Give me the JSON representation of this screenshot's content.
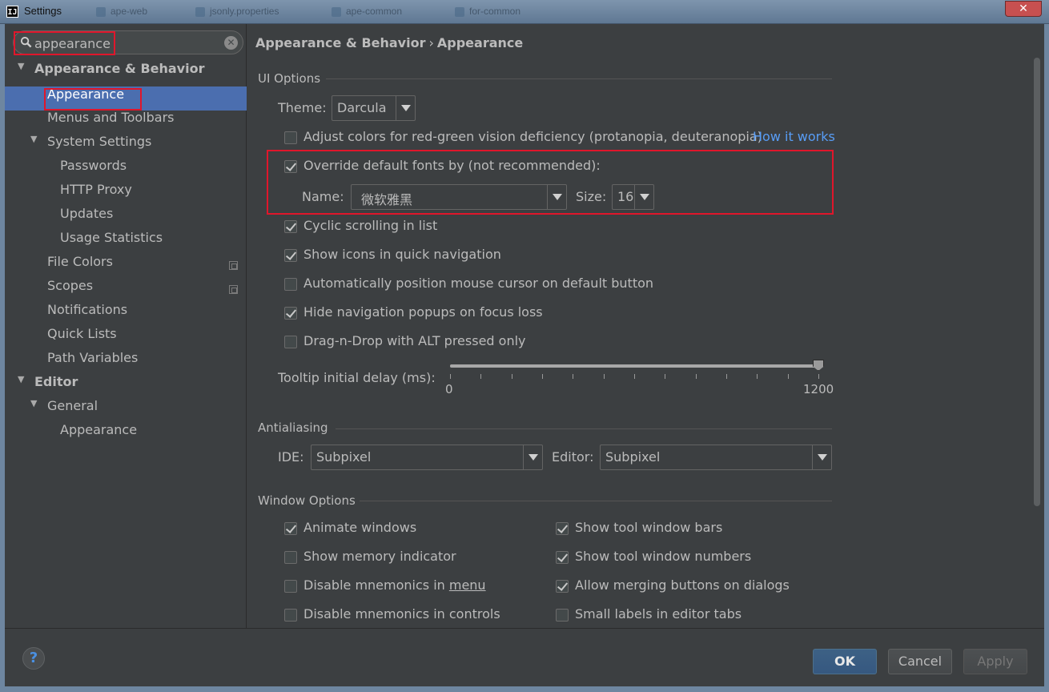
{
  "window": {
    "title": "Settings",
    "app_icon": "IJ",
    "bg_tabs": [
      "ape-web",
      "jsonly.properties",
      "ape-common",
      "for-common"
    ],
    "close_glyph": "✕"
  },
  "search": {
    "value": "appearance",
    "clear_glyph": "✕"
  },
  "sidebar": {
    "appearance_behavior": "Appearance & Behavior",
    "appearance": "Appearance",
    "menus_toolbars": "Menus and Toolbars",
    "system_settings": "System Settings",
    "passwords": "Passwords",
    "http_proxy": "HTTP Proxy",
    "updates": "Updates",
    "usage_statistics": "Usage Statistics",
    "file_colors": "File Colors",
    "scopes": "Scopes",
    "notifications": "Notifications",
    "quick_lists": "Quick Lists",
    "path_variables": "Path Variables",
    "editor": "Editor",
    "general": "General",
    "editor_appearance": "Appearance",
    "expanded_glyph": "▼"
  },
  "breadcrumb": {
    "part1": "Appearance & Behavior",
    "sep": "›",
    "part2": "Appearance"
  },
  "ui_options": {
    "title": "UI Options",
    "theme_label": "Theme:",
    "theme_value": "Darcula",
    "adjust_colors": "Adjust colors for red-green vision deficiency (protanopia, deuteranopia)",
    "how_it_works": "How it works",
    "override_fonts": "Override default fonts by (not recommended):",
    "name_label": "Name:",
    "name_value": "微软雅黑",
    "size_label": "Size:",
    "size_value": "16",
    "cyclic_scrolling": "Cyclic scrolling in list",
    "show_icons": "Show icons in quick navigation",
    "auto_position": "Automatically position mouse cursor on default button",
    "hide_popups": "Hide navigation popups on focus loss",
    "drag_drop": "Drag-n-Drop with ALT pressed only",
    "tooltip_label": "Tooltip initial delay (ms):",
    "tooltip_min": "0",
    "tooltip_max": "1200",
    "tooltip_value": 1200,
    "checked": {
      "adjust_colors": false,
      "override_fonts": true,
      "cyclic_scrolling": true,
      "show_icons": true,
      "auto_position": false,
      "hide_popups": true,
      "drag_drop": false
    }
  },
  "antialiasing": {
    "title": "Antialiasing",
    "ide_label": "IDE:",
    "ide_value": "Subpixel",
    "editor_label": "Editor:",
    "editor_value": "Subpixel"
  },
  "window_options": {
    "title": "Window Options",
    "animate_windows": "Animate windows",
    "show_memory": "Show memory indicator",
    "disable_mnemonics_menu_pre": "Disable mnemonics in ",
    "disable_mnemonics_menu_u": "menu",
    "disable_mnemonics_controls": "Disable mnemonics in controls",
    "show_tool_bars": "Show tool window bars",
    "show_tool_numbers": "Show tool window numbers",
    "allow_merging": "Allow merging buttons on dialogs",
    "small_labels": "Small labels in editor tabs",
    "checked": {
      "animate_windows": true,
      "show_memory": false,
      "disable_mnemonics_menu": false,
      "disable_mnemonics_controls": false,
      "show_tool_bars": true,
      "show_tool_numbers": true,
      "allow_merging": true,
      "small_labels": false
    }
  },
  "buttons": {
    "help": "?",
    "ok": "OK",
    "cancel": "Cancel",
    "apply": "Apply"
  },
  "colors": {
    "accent": "#4b6eaf",
    "link": "#589df6",
    "highlight": "#e0162b",
    "background": "#3c3f41"
  }
}
